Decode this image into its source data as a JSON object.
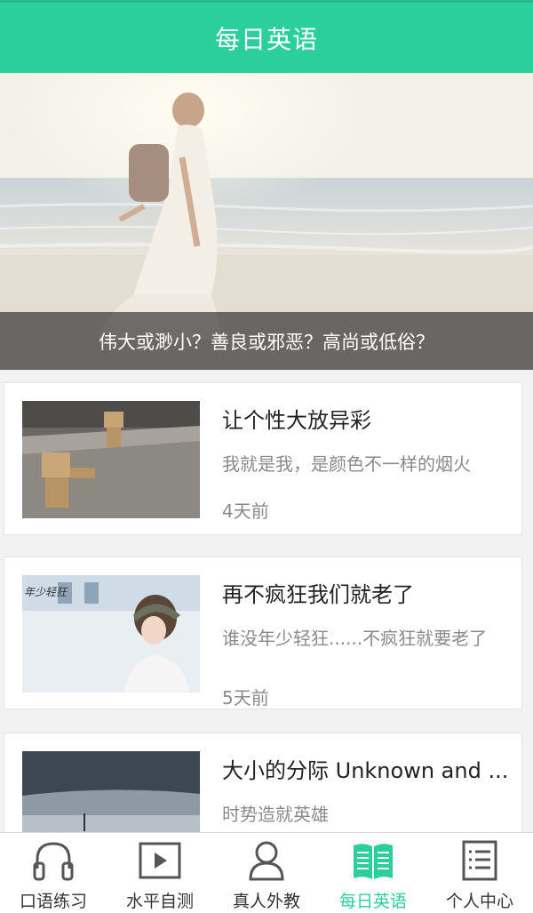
{
  "header": {
    "title": "每日英语"
  },
  "banner": {
    "caption": "伟大或渺小？善良或邪恶？高尚或低俗？"
  },
  "articles": [
    {
      "title": "让个性大放异彩",
      "summary": "我就是我，是颜色不一样的烟火",
      "time": "4天前"
    },
    {
      "title": "再不疯狂我们就老了",
      "summary": "谁没年少轻狂......不疯狂就要老了",
      "time": "5天前",
      "thumb_text": "年少轻狂"
    },
    {
      "title": "大小的分际 Unknown and ...",
      "summary": "时势造就英雄",
      "time": ""
    }
  ],
  "tabs": [
    {
      "label": "口语练习",
      "icon": "headphones-icon",
      "active": false
    },
    {
      "label": "水平自测",
      "icon": "play-video-icon",
      "active": false
    },
    {
      "label": "真人外教",
      "icon": "person-icon",
      "active": false
    },
    {
      "label": "每日英语",
      "icon": "open-book-icon",
      "active": true
    },
    {
      "label": "个人中心",
      "icon": "document-list-icon",
      "active": false
    }
  ],
  "colors": {
    "accent": "#2bcf9c",
    "tab_inactive": "#555555"
  }
}
